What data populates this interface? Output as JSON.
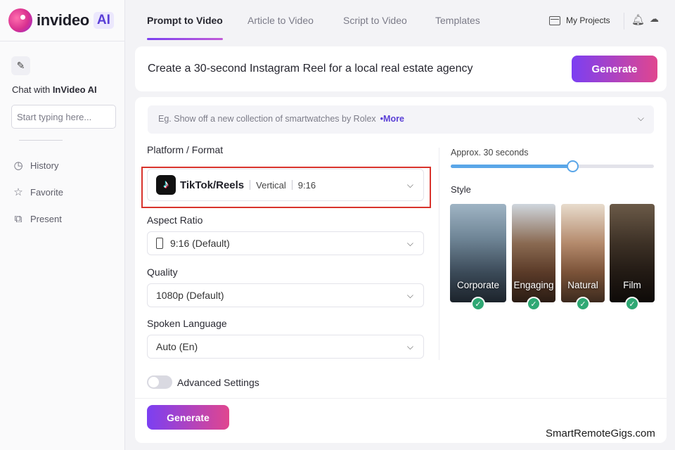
{
  "brand": {
    "name": "invideo",
    "badge": "AI"
  },
  "sidebar": {
    "chat_label_prefix": "Chat with ",
    "chat_label_bold": "InVideo AI",
    "chat_placeholder": "Start typing here...",
    "items": [
      {
        "label": "History",
        "icon": "clock-icon"
      },
      {
        "label": "Favorite",
        "icon": "star-icon"
      },
      {
        "label": "Present",
        "icon": "present-icon"
      }
    ]
  },
  "header": {
    "tabs": [
      {
        "label": "Prompt to Video",
        "active": true
      },
      {
        "label": "Article to Video",
        "active": false
      },
      {
        "label": "Script to Video",
        "active": false
      },
      {
        "label": "Templates",
        "active": false
      }
    ],
    "projects_label": "My Projects"
  },
  "prompt": {
    "text": "Create a 30-second Instagram Reel for a local real estate agency",
    "generate_label": "Generate"
  },
  "settings": {
    "example_text": "Eg. Show off a new collection of smartwatches by Rolex",
    "example_more": "•More",
    "platform": {
      "label": "Platform / Format",
      "name": "TikTok/Reels",
      "orientation": "Vertical",
      "ratio": "9:16"
    },
    "aspect_ratio": {
      "label": "Aspect Ratio",
      "value": "9:16 (Default)"
    },
    "quality": {
      "label": "Quality",
      "value": "1080p (Default)"
    },
    "language": {
      "label": "Spoken Language",
      "value": "Auto (En)"
    },
    "duration": {
      "label": "Approx. 30 seconds",
      "slider_fraction": 0.6
    },
    "style": {
      "label": "Style",
      "options": [
        {
          "label": "Corporate",
          "selected": true
        },
        {
          "label": "Engaging",
          "selected": true
        },
        {
          "label": "Natural",
          "selected": true
        },
        {
          "label": "Film",
          "selected": true
        }
      ]
    },
    "advanced_label": "Advanced Settings",
    "generate_label": "Generate"
  },
  "watermark": "SmartRemoteGigs.com",
  "colors": {
    "accent_start": "#7b3ff2",
    "accent_end": "#e0468f",
    "highlight": "#d8332c",
    "check": "#2fa874"
  }
}
